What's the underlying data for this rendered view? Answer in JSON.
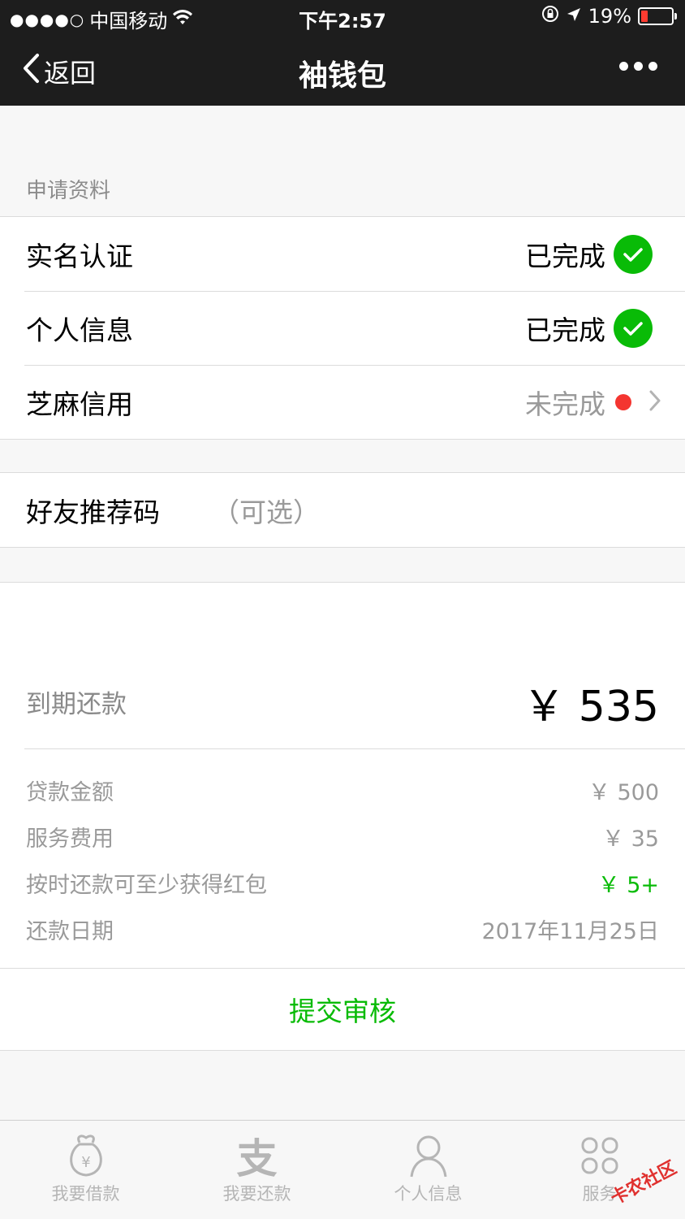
{
  "status_bar": {
    "signal": "●●●●○",
    "carrier": "中国移动",
    "time": "下午2:57",
    "battery": "19%"
  },
  "nav": {
    "back_label": "返回",
    "title": "袖钱包"
  },
  "application": {
    "section_label": "申请资料",
    "items": [
      {
        "label": "实名认证",
        "status": "已完成"
      },
      {
        "label": "个人信息",
        "status": "已完成"
      },
      {
        "label": "芝麻信用",
        "status": "未完成"
      }
    ]
  },
  "referral": {
    "label": "好友推荐码",
    "hint": "（可选）"
  },
  "summary": {
    "due_label": "到期还款",
    "due_amount": "￥ 535",
    "details": [
      {
        "key": "贷款金额",
        "value": "￥ 500"
      },
      {
        "key": "服务费用",
        "value": "￥ 35"
      },
      {
        "key": "按时还款可至少获得红包",
        "value": "￥ 5+"
      },
      {
        "key": "还款日期",
        "value": "2017年11月25日"
      }
    ]
  },
  "submit_label": "提交审核",
  "tabbar": {
    "tabs": [
      {
        "label": "我要借款",
        "icon": "money-bag-icon"
      },
      {
        "label": "我要还款",
        "icon": "alipay-icon",
        "glyph": "支"
      },
      {
        "label": "个人信息",
        "icon": "person-icon"
      },
      {
        "label": "服务",
        "icon": "grid-icon"
      }
    ]
  },
  "watermark": "卡农社区",
  "colors": {
    "accent_green": "#09bb07",
    "pending_red": "#f43530",
    "nav_bg": "#1d1d1d"
  }
}
